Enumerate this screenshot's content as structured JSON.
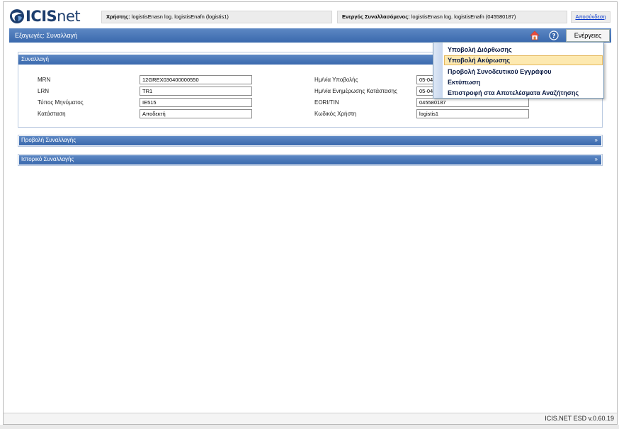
{
  "header": {
    "logo_text_a": "ICIS",
    "logo_text_b": "net",
    "user_label": "Χρήστης:",
    "user_value": "logistisEnasn log. logistisEnafn (logistis1)",
    "trader_label": "Ενεργός Συναλλασόμενος:",
    "trader_value": "logistisEnasn log. logistisEnafn (045580187)",
    "logout": "Αποσύνδεση"
  },
  "titlebar": {
    "title": "Εξαγωγές: Συναλλαγή",
    "home_icon": "home-icon",
    "help_icon": "help-icon",
    "actions_label": "Ενέργειες"
  },
  "transaction": {
    "header": "Συναλλαγή",
    "left_fields": [
      {
        "label": "MRN",
        "value": "12GREX030400000550"
      },
      {
        "label": "LRN",
        "value": "TR1"
      },
      {
        "label": "Τύπος Μηνύματος",
        "value": "IE515"
      },
      {
        "label": "Κατάσταση",
        "value": "Αποδεκτή"
      }
    ],
    "right_fields": [
      {
        "label": "Ημ/νία Υποβολής",
        "value": "05-04-"
      },
      {
        "label": "Ημ/νία Ενημέρωσης Κατάστασης",
        "value": "05-04-"
      },
      {
        "label": "EORI/TIN",
        "value": "045580187"
      },
      {
        "label": "Κωδικός Χρήστη",
        "value": "logistis1"
      }
    ]
  },
  "sections": {
    "view": "Προβολή Συναλλαγής",
    "history": "Ιστορικό Συναλλαγής",
    "expand_glyph": "»"
  },
  "actions_menu": {
    "items": [
      "Υποβολή Διόρθωσης",
      "Υποβολή Ακύρωσης",
      "Προβολή Συνοδευτικού Εγγράφου",
      "Εκτύπωση",
      "Επιστροφή στα Αποτελέσματα Αναζήτησης"
    ],
    "highlight_color": "#fde9b0"
  },
  "footer": {
    "version": "ICIS.NET ESD v.0.60.19"
  },
  "colors": {
    "bar_blue": "#3a69ad",
    "logo_navy": "#1d3e6e",
    "link": "#0033cc"
  }
}
